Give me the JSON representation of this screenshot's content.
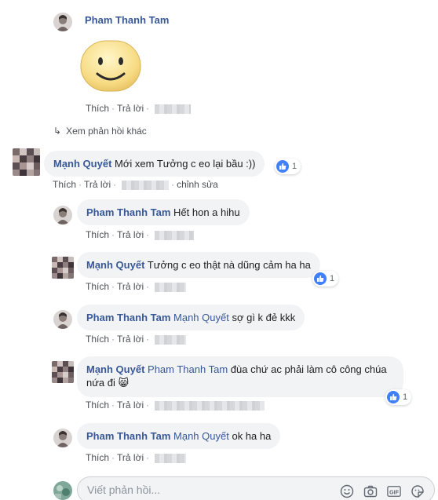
{
  "thread": {
    "top_comment": {
      "author": "Pham Thanh Tam",
      "sticker": "smiley-sticker",
      "actions": {
        "like": "Thích",
        "reply": "Trả lời"
      }
    },
    "more_replies_label": "Xem phản hồi khác",
    "main_comment": {
      "author": "Mạnh Quyết",
      "text": "Mới xem Tưởng c eo lại bầu :))",
      "reaction_count": "1",
      "actions": {
        "like": "Thích",
        "reply": "Trả lời",
        "edited": "chỉnh sửa"
      }
    },
    "replies": [
      {
        "author": "Pham Thanh Tam",
        "mention": "",
        "text": "Hết hon a hihu",
        "actions": {
          "like": "Thích",
          "reply": "Trả lời"
        }
      },
      {
        "author": "Mạnh Quyết",
        "mention": "",
        "text": "Tưởng c eo thật nà dũng cảm ha ha",
        "reaction_count": "1",
        "actions": {
          "like": "Thích",
          "reply": "Trả lời"
        }
      },
      {
        "author": "Pham Thanh Tam",
        "mention": "Mạnh Quyết",
        "text": "sợ gì k đẻ kkk",
        "actions": {
          "like": "Thích",
          "reply": "Trả lời"
        }
      },
      {
        "author": "Mạnh Quyết",
        "mention": "Pham Thanh Tam",
        "text": "đùa chứ ac phải làm cô công chúa nứa đi",
        "emoji": "😸",
        "reaction_count": "1",
        "actions": {
          "like": "Thích",
          "reply": "Trả lời"
        }
      },
      {
        "author": "Pham Thanh Tam",
        "mention": "Mạnh Quyết",
        "text": "ok ha ha",
        "actions": {
          "like": "Thích",
          "reply": "Trả lời"
        }
      }
    ]
  },
  "composer": {
    "placeholder": "Viết phản hồi...",
    "icons": [
      "emoji-icon",
      "camera-icon",
      "gif-icon",
      "sticker-icon"
    ]
  },
  "colors": {
    "link": "#385898",
    "bubble": "#f2f3f5",
    "like": "#4080ff",
    "meta": "#606770"
  }
}
